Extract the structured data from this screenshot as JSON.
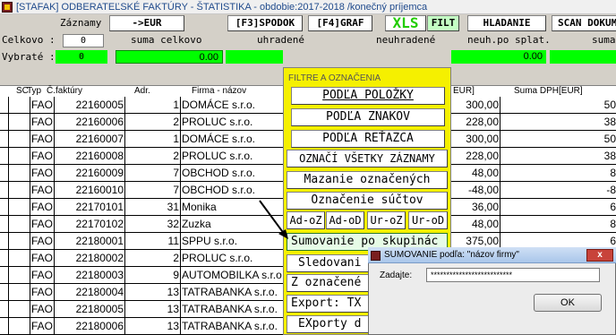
{
  "window": {
    "title": "[STAFAK] ODBERATEĽSKÉ FAKTÚRY - ŠTATISTIKA - obdobie:2017-2018 /konečný príjemca"
  },
  "toolbar": {
    "zaznamy_label": "Záznamy",
    "eur_button": "->EUR",
    "f3_button": "[F3]SPODOK",
    "f4_button": "[F4]GRAF",
    "xls_button": "XLS",
    "filt_button": "FILT",
    "hladanie_button": "HLADANIE",
    "scan_button": "SCAN DOKUM"
  },
  "summary": {
    "celkovo_label": "Celkovo :",
    "celkovo_count": "0",
    "suma_celkovo_label": "suma celkovo",
    "uhradene_label": "uhradené",
    "neuhradene_label": "neuhradené",
    "neuh_po_splat_label": "neuh.po splat.",
    "suma_label": "suma",
    "vybrate_label": "Vybraté :",
    "vybrate_count": "0",
    "vybrate_sum": "0.00",
    "vybrate_sum2": "0.00"
  },
  "table": {
    "headers": {
      "sc": "SC",
      "typ": "Typ",
      "faktura": "Č.faktúry",
      "adr": "Adr.",
      "firma": "Firma - názov",
      "eur": "EUR]",
      "suma_dph": "Suma DPH[EUR]"
    },
    "rows": [
      {
        "typ": "FAO",
        "faktura": "22160005",
        "adr": "1",
        "firma": "DOMÁCE s.r.o.",
        "eur": "300,00",
        "dph": "50"
      },
      {
        "typ": "FAO",
        "faktura": "22160006",
        "adr": "2",
        "firma": "PROLUC s.r.o.",
        "eur": "228,00",
        "dph": "38"
      },
      {
        "typ": "FAO",
        "faktura": "22160007",
        "adr": "1",
        "firma": "DOMÁCE s.r.o.",
        "eur": "300,00",
        "dph": "50"
      },
      {
        "typ": "FAO",
        "faktura": "22160008",
        "adr": "2",
        "firma": "PROLUC s.r.o.",
        "eur": "228,00",
        "dph": "38"
      },
      {
        "typ": "FAO",
        "faktura": "22160009",
        "adr": "7",
        "firma": "OBCHOD s.r.o.",
        "eur": "48,00",
        "dph": "8"
      },
      {
        "typ": "FAO",
        "faktura": "22160010",
        "adr": "7",
        "firma": "OBCHOD s.r.o.",
        "eur": "-48,00",
        "dph": "-8"
      },
      {
        "typ": "FAO",
        "faktura": "22170101",
        "adr": "31",
        "firma": "Monika",
        "eur": "36,00",
        "dph": "6"
      },
      {
        "typ": "FAO",
        "faktura": "22170102",
        "adr": "32",
        "firma": "Zuzka",
        "eur": "48,00",
        "dph": "8"
      },
      {
        "typ": "FAO",
        "faktura": "22180001",
        "adr": "11",
        "firma": "SPPU s.r.o.",
        "eur": "375,00",
        "dph": "6"
      },
      {
        "typ": "FAO",
        "faktura": "22180002",
        "adr": "2",
        "firma": "PROLUC s.r.o.",
        "eur": "",
        "dph": ""
      },
      {
        "typ": "FAO",
        "faktura": "22180003",
        "adr": "9",
        "firma": "AUTOMOBILKA s.r.o.",
        "eur": "",
        "dph": ""
      },
      {
        "typ": "FAO",
        "faktura": "22180004",
        "adr": "13",
        "firma": "TATRABANKA s.r.o.",
        "eur": "",
        "dph": ""
      },
      {
        "typ": "FAO",
        "faktura": "22180005",
        "adr": "13",
        "firma": "TATRABANKA s.r.o.",
        "eur": "",
        "dph": ""
      },
      {
        "typ": "FAO",
        "faktura": "22180006",
        "adr": "13",
        "firma": "TATRABANKA s.r.o.",
        "eur": "",
        "dph": ""
      }
    ]
  },
  "filter_menu": {
    "header": "FILTRE A OZNAČENIA",
    "by_item": "PODĽA POLOŽKY",
    "by_chars": "PODĽA ZNAKOV",
    "by_string": "PODĽA REŤAZCA",
    "mark_all": "OZNAČÍ VŠETKY ZÁZNAMY",
    "delete_marked": "Mazanie označených",
    "mark_sums": "Označenie súčtov",
    "ad_oz": "Ad-oZ",
    "ad_od": "Ad-oD",
    "ur_oz": "Ur-oZ",
    "ur_od": "Ur-oD",
    "sum_groups": "Sumovanie po skupinác",
    "tracking": "Sledovani",
    "from_marked": "Z označené",
    "export_tx": "Export: TX",
    "exports": "EXporty d"
  },
  "dialog": {
    "title": "SUMOVANIE podľa: \"názov firmy\"",
    "close": "x",
    "input_label": "Zadajte:",
    "input_value": "**************************",
    "ok": "OK"
  },
  "colors": {
    "menu_bg": "#f5f000",
    "green": "#00ff00",
    "xls": "#22cc00"
  }
}
